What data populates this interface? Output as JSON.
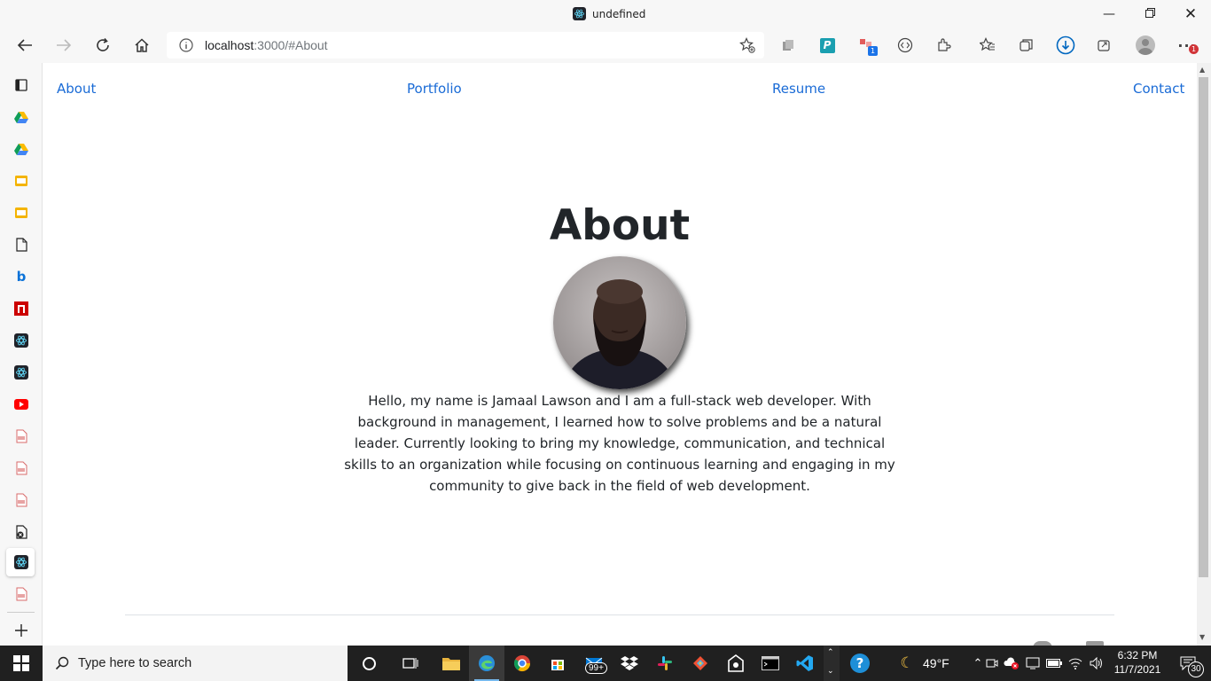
{
  "window": {
    "title": "undefined"
  },
  "browser": {
    "url_host": "localhost",
    "url_path": ":3000/#About"
  },
  "site_nav": {
    "about": "About",
    "portfolio": "Portfolio",
    "resume": "Resume",
    "contact": "Contact"
  },
  "main": {
    "heading": "About",
    "bio": "Hello, my name is Jamaal Lawson and I am a full-stack web developer. With background in management, I learned how to solve problems and be a natural leader. Currently looking to bring my knowledge, communication, and technical skills to an organization while focusing on continuous learning and engaging in my community to give back in the field of web development."
  },
  "taskbar": {
    "search_placeholder": "Type here to search",
    "mail_badge": "99+",
    "temperature": "49°F",
    "time": "6:32 PM",
    "date": "11/7/2021",
    "notifications": "30"
  },
  "extensions": {
    "badge": "1"
  },
  "menu_badge": "1",
  "colors": {
    "link": "#1a6bd6",
    "taskbar": "#202020",
    "accent": "#0078d4"
  }
}
